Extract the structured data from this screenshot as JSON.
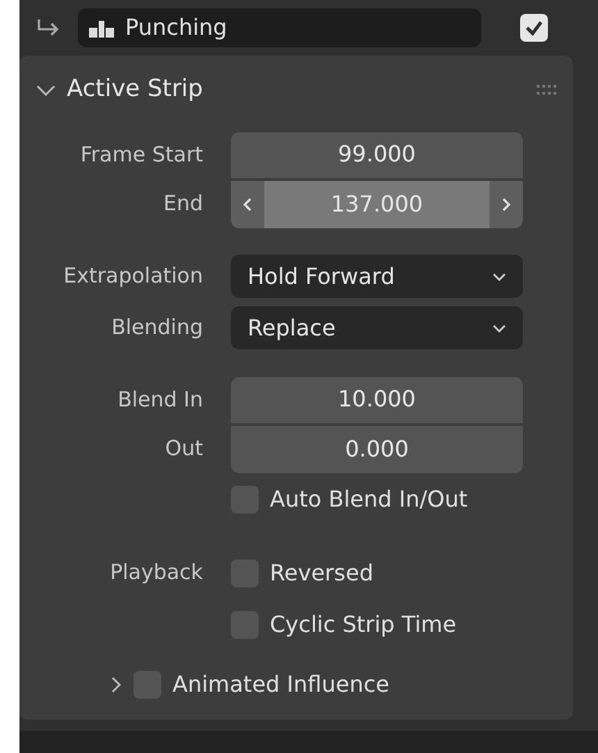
{
  "header_bar": {
    "strip_name": "Punching",
    "enabled": true
  },
  "panel": {
    "title": "Active Strip",
    "expanded": true
  },
  "sections": [
    {
      "rows": [
        {
          "kind": "number",
          "label": "Frame Start",
          "value": "99.000",
          "hovered": false
        },
        {
          "kind": "number",
          "label": "End",
          "value": "137.000",
          "hovered": true
        }
      ]
    },
    {
      "rows": [
        {
          "kind": "dropdown",
          "label": "Extrapolation",
          "value": "Hold Forward"
        },
        {
          "kind": "dropdown",
          "label": "Blending",
          "value": "Replace"
        }
      ]
    },
    {
      "rows": [
        {
          "kind": "number",
          "label": "Blend In",
          "value": "10.000",
          "hovered": false
        },
        {
          "kind": "number",
          "label": "Out",
          "value": "0.000",
          "hovered": false
        },
        {
          "kind": "checkbox",
          "text": "Auto Blend In/Out",
          "checked": false
        }
      ]
    },
    {
      "rows": [
        {
          "kind": "checkbox",
          "label": "Playback",
          "text": "Reversed",
          "checked": false
        },
        {
          "kind": "checkbox",
          "text": "Cyclic Strip Time",
          "checked": false
        }
      ]
    }
  ],
  "subpanel": {
    "title": "Animated Influence",
    "expanded": false,
    "checked": false
  }
}
